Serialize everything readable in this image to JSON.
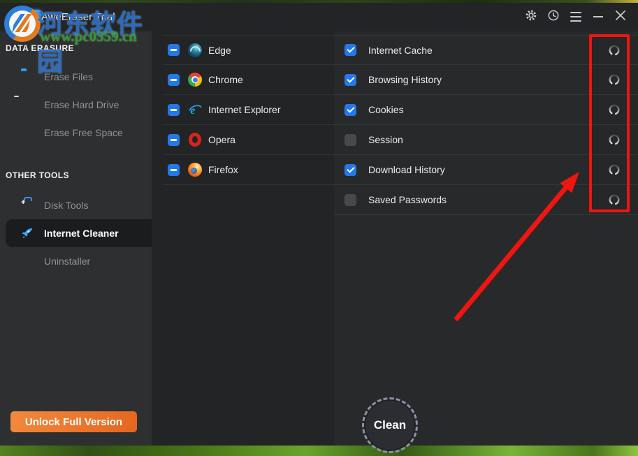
{
  "window": {
    "title": "AweEraser Trial",
    "controls": [
      {
        "icon": "gear-icon"
      },
      {
        "icon": "clock-history-icon"
      },
      {
        "icon": "hamburger-menu-icon"
      },
      {
        "icon": "minimize-icon"
      },
      {
        "icon": "close-icon"
      }
    ]
  },
  "watermark": {
    "site_name": "河东软件园",
    "site_url": "www.pc0359.cn"
  },
  "sidebar": {
    "sections": [
      {
        "title": "DATA ERASURE",
        "items": [
          {
            "label": "Erase Files",
            "icon": "folder-icon",
            "active": false
          },
          {
            "label": "Erase Hard Drive",
            "icon": "hard-drive-icon",
            "active": false
          },
          {
            "label": "Erase Free Space",
            "icon": "pie-chart-icon",
            "active": false
          }
        ]
      },
      {
        "title": "OTHER TOOLS",
        "items": [
          {
            "label": "Disk Tools",
            "icon": "toolbox-icon",
            "active": false
          },
          {
            "label": "Internet Cleaner",
            "icon": "rocket-icon",
            "active": true
          },
          {
            "label": "Uninstaller",
            "icon": "app-grid-icon",
            "active": false
          }
        ]
      }
    ],
    "unlock_button_label": "Unlock Full Version"
  },
  "browsers": [
    {
      "name": "Edge",
      "icon": "edge-icon",
      "state": "indeterminate"
    },
    {
      "name": "Chrome",
      "icon": "chrome-icon",
      "state": "indeterminate"
    },
    {
      "name": "Internet Explorer",
      "icon": "internet-explorer-icon",
      "state": "indeterminate"
    },
    {
      "name": "Opera",
      "icon": "opera-icon",
      "state": "indeterminate"
    },
    {
      "name": "Firefox",
      "icon": "firefox-icon",
      "state": "indeterminate"
    }
  ],
  "clean_items": [
    {
      "label": "Internet Cache",
      "state": "checked",
      "status": "spinner-icon"
    },
    {
      "label": "Browsing History",
      "state": "checked",
      "status": "spinner-icon"
    },
    {
      "label": "Cookies",
      "state": "checked",
      "status": "spinner-icon"
    },
    {
      "label": "Session",
      "state": "unchecked",
      "status": "spinner-icon"
    },
    {
      "label": "Download History",
      "state": "checked",
      "status": "spinner-icon"
    },
    {
      "label": "Saved Passwords",
      "state": "unchecked",
      "status": "spinner-icon"
    }
  ],
  "clean_button_label": "Clean",
  "annotations": {
    "highlight_box_target": "status-spinner-column",
    "arrow_target": "status-spinner-column"
  },
  "colors": {
    "accent_blue": "#2478e8",
    "unlock_orange": "#e8762b",
    "annotation_red": "#ef1511",
    "sidebar_bg": "#2e2f30",
    "window_bg": "#232425"
  }
}
